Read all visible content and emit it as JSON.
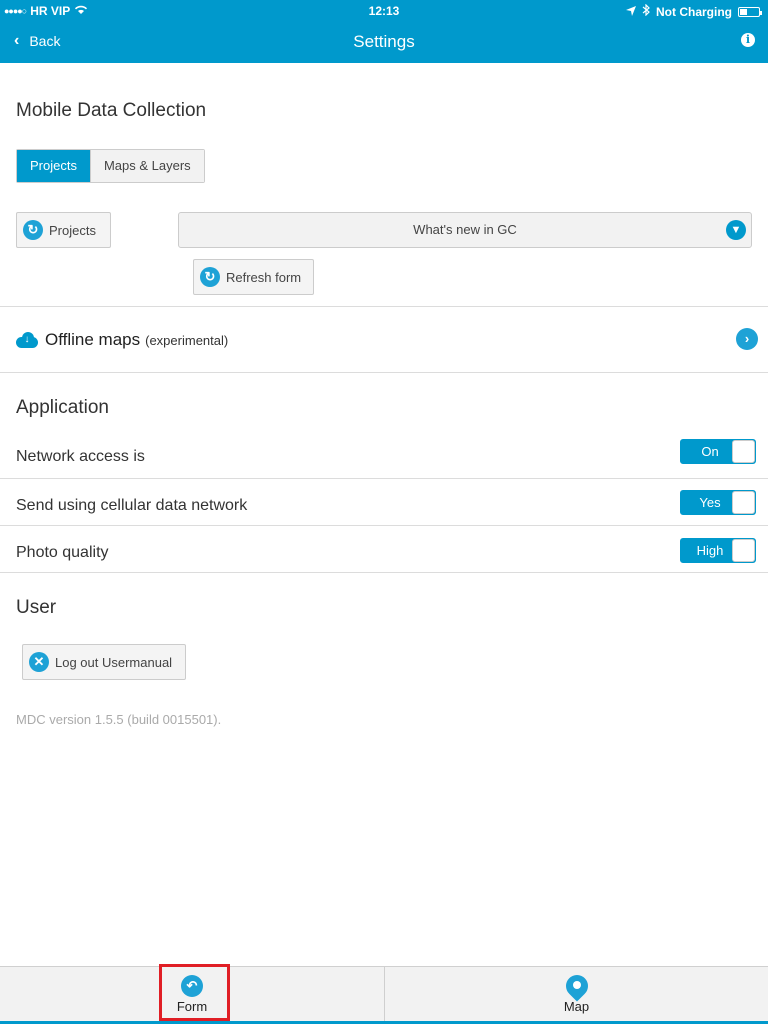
{
  "status_bar": {
    "carrier": "HR VIP",
    "time": "12:13",
    "charging": "Not Charging"
  },
  "navbar": {
    "back_label": "Back",
    "title": "Settings",
    "info_glyph": "i"
  },
  "mdc": {
    "heading": "Mobile Data Collection",
    "tabs": [
      {
        "label": "Projects",
        "active": true
      },
      {
        "label": "Maps & Layers",
        "active": false
      }
    ],
    "projects_button": "Projects",
    "project_select": "What's new in GC",
    "refresh_button": "Refresh form"
  },
  "offline_maps": {
    "title": "Offline maps",
    "subtitle": "(experimental)"
  },
  "application": {
    "heading": "Application",
    "settings": [
      {
        "label": "Network access is",
        "toggle": "On"
      },
      {
        "label": "Send using cellular data network",
        "toggle": "Yes"
      },
      {
        "label": "Photo quality",
        "toggle": "High"
      }
    ]
  },
  "user": {
    "heading": "User",
    "logout_button": "Log out Usermanual"
  },
  "version": "MDC version 1.5.5 (build 0015501).",
  "tabbar": {
    "tabs": [
      {
        "label": "Form",
        "icon": "form-icon",
        "highlighted": true
      },
      {
        "label": "Map",
        "icon": "map-pin-icon",
        "highlighted": false
      }
    ]
  },
  "colors": {
    "accent": "#0099cc",
    "highlight": "#e01e25"
  }
}
